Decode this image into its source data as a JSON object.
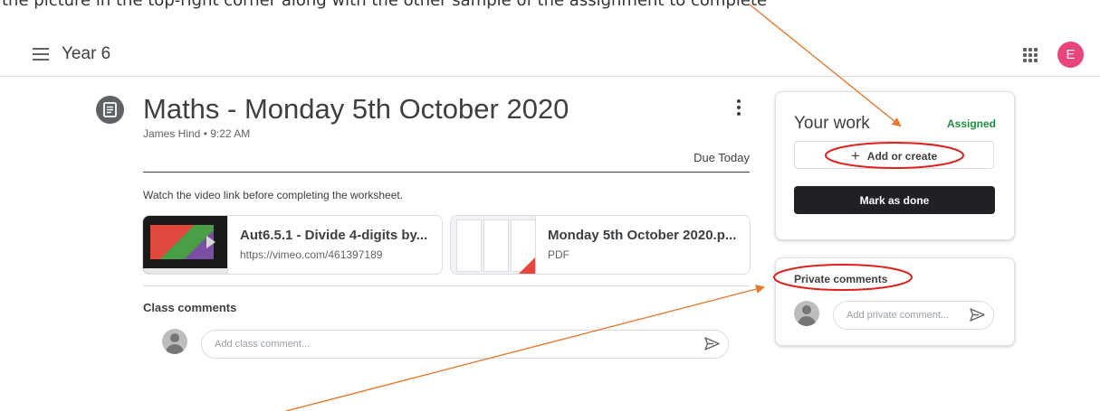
{
  "caption": "the picture in the top-right corner along with the other sample of the assignment to complete",
  "topbar": {
    "class_name": "Year 6",
    "avatar_letter": "E"
  },
  "assignment": {
    "title": "Maths - Monday 5th October 2020",
    "author": "James Hind",
    "time": "9:22 AM",
    "separator": "•",
    "due": "Due Today",
    "instructions": "Watch the video link before completing the worksheet."
  },
  "attachments": [
    {
      "title": "Aut6.5.1 - Divide 4-digits by...",
      "subtitle": "https://vimeo.com/461397189",
      "icon": "video-thumbnail"
    },
    {
      "title": "Monday 5th October 2020.p...",
      "subtitle": "PDF",
      "icon": "pdf-thumbnail"
    }
  ],
  "class_comments": {
    "heading": "Class comments",
    "placeholder": "Add class comment..."
  },
  "your_work": {
    "heading": "Your work",
    "status": "Assigned",
    "add_button": "Add or create",
    "add_icon": "+",
    "done_button": "Mark as done"
  },
  "private_comments": {
    "heading": "Private comments",
    "placeholder": "Add private comment..."
  },
  "colors": {
    "status": "#1e8e3e",
    "avatar": "#e8457b",
    "annotation": "#e8792b",
    "annotation_circle": "#e0201b",
    "primary_button": "#202124"
  }
}
